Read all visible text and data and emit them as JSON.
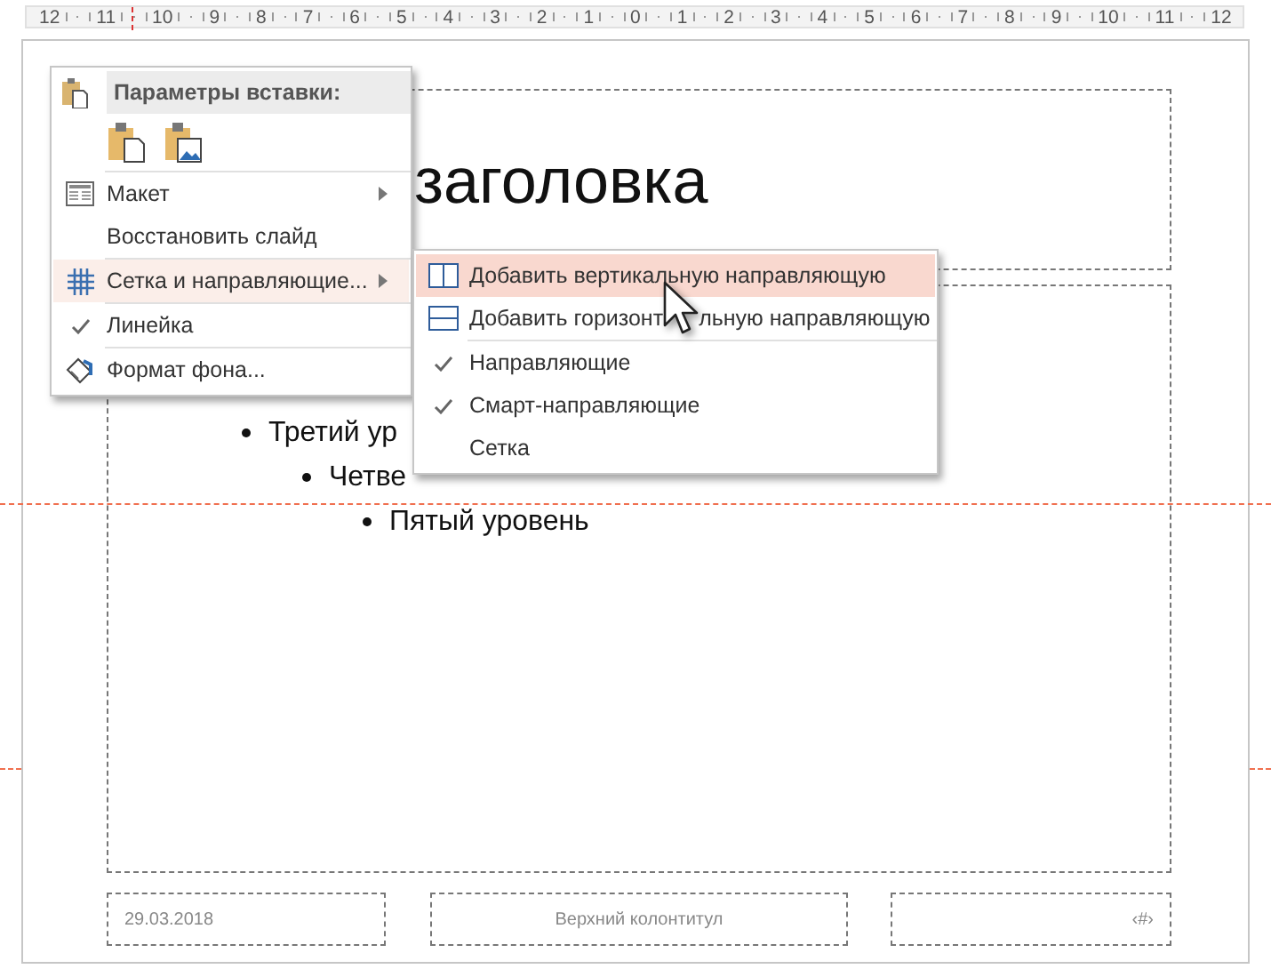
{
  "ruler": {
    "labels": [
      "12",
      "11",
      "10",
      "9",
      "8",
      "7",
      "6",
      "5",
      "4",
      "3",
      "2",
      "1",
      "0",
      "1",
      "2",
      "3",
      "4",
      "5",
      "6",
      "7",
      "8",
      "9",
      "10",
      "11",
      "12"
    ]
  },
  "slide": {
    "title": "заголовка",
    "bullets": [
      {
        "text": "Третий ур"
      },
      {
        "text": "Четве"
      },
      {
        "text": "Пятый уровень"
      }
    ],
    "footer": {
      "date": "29.03.2018",
      "header": "Верхний колонтитул",
      "number": "‹#›"
    }
  },
  "context_menu": {
    "paste_header": "Параметры вставки:",
    "groups": [
      [
        {
          "label": "Макет",
          "selected": false,
          "submenu": true
        },
        {
          "label": "Восстановить слайд",
          "checked": false,
          "selected": false,
          "submenu": false
        }
      ],
      [
        {
          "label": "Сетка и направляющие...",
          "selected": true,
          "submenu": true
        }
      ],
      [
        {
          "label": "Линейка",
          "checked": true,
          "selected": false,
          "submenu": false
        }
      ],
      [
        {
          "label": "Формат фона...",
          "selected": false,
          "submenu": false
        }
      ]
    ]
  },
  "submenu": {
    "groups": [
      [
        {
          "label": "Добавить вертикальную направляющую",
          "selected": true
        },
        {
          "label": "Добавить горизонт",
          "label_after_cursor": "льную направляющую",
          "selected": false
        }
      ],
      [
        {
          "label": "Направляющие",
          "checked": true,
          "selected": false
        },
        {
          "label": "Смарт-направляющие",
          "checked": true,
          "selected": false
        },
        {
          "label": "Сетка",
          "checked": false,
          "selected": false
        }
      ]
    ]
  }
}
